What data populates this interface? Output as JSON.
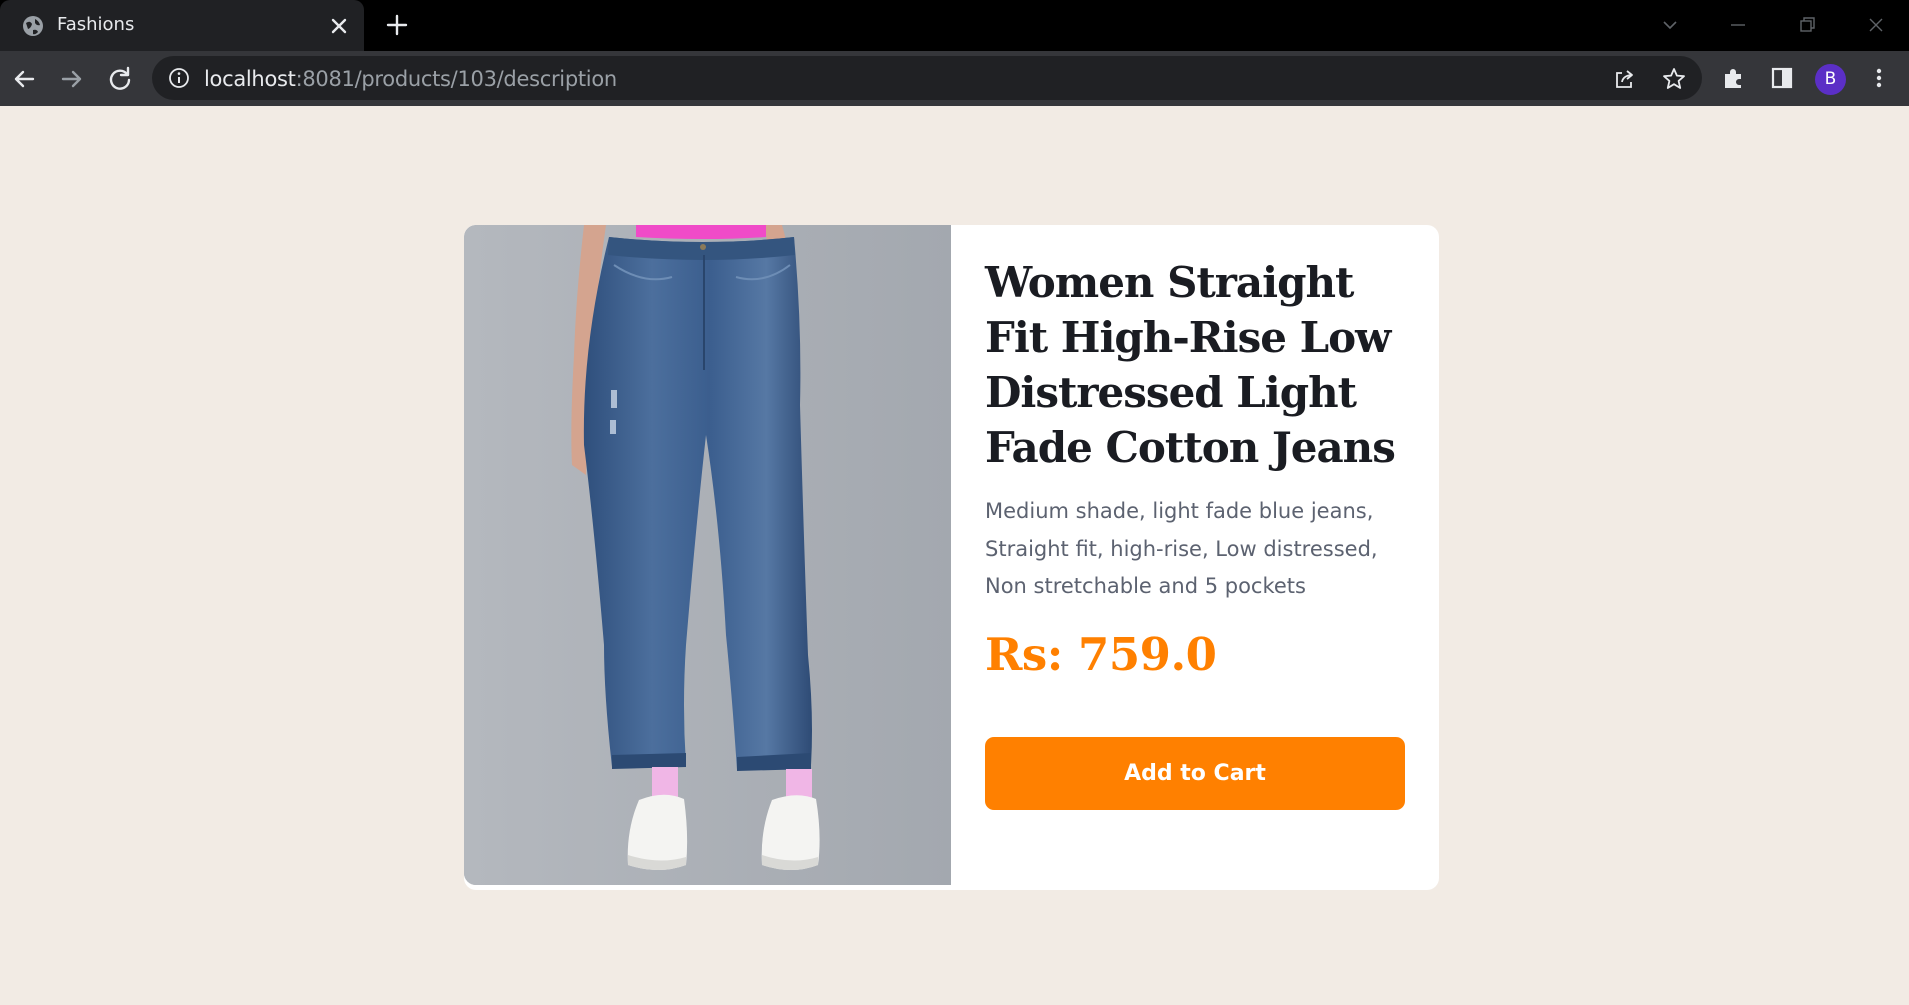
{
  "browser": {
    "tab_title": "Fashions",
    "url_host": "localhost",
    "url_path": ":8081/products/103/description",
    "profile_initial": "B"
  },
  "icons": {
    "favicon": "globe-icon",
    "tab_close": "close-icon",
    "new_tab": "plus-icon",
    "tab_search": "chevron-down-icon",
    "minimize": "minimize-icon",
    "restore": "restore-icon",
    "close_window": "close-icon",
    "back": "arrow-left-icon",
    "forward": "arrow-right-icon",
    "reload": "reload-icon",
    "site_info": "info-icon",
    "share": "share-icon",
    "bookmark": "star-icon",
    "extensions": "puzzle-icon",
    "side_panel": "side-panel-icon",
    "menu": "kebab-menu-icon"
  },
  "product": {
    "title": "Women Straight Fit High-Rise Low Distressed Light Fade Cotton Jeans",
    "description": "Medium shade, light fade blue jeans, Straight fit, high-rise, Low distressed, Non stretchable and 5 pockets",
    "price": "Rs: 759.0",
    "add_to_cart_label": "Add to Cart"
  },
  "colors": {
    "page_background": "#f2ebe4",
    "accent": "#ff8000",
    "title_text": "#1a1c22",
    "description_text": "#5c6270",
    "denim": "#3c5f8f",
    "photo_background": "#a9aeb4"
  }
}
